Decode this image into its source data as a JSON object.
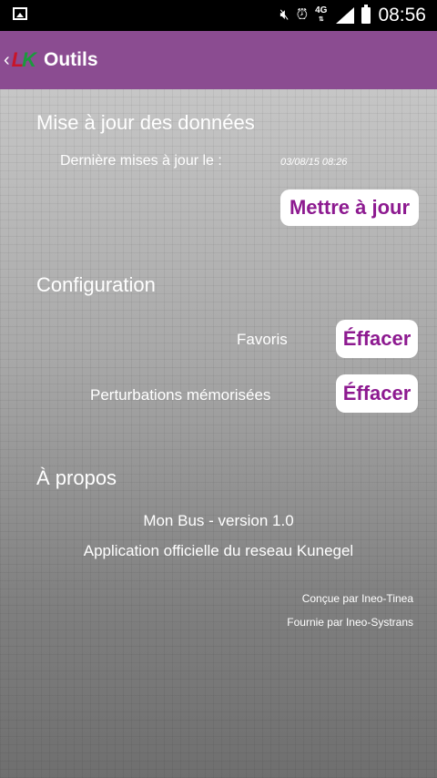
{
  "status_bar": {
    "network": "4G",
    "time": "08:56"
  },
  "app_bar": {
    "logo_text_1": "L",
    "logo_text_2": "K",
    "title": "Outils"
  },
  "update_section": {
    "title": "Mise à jour des données",
    "last_update_label": "Dernière mises à jour le :",
    "last_update_value": "03/08/15 08:26",
    "update_button": "Mettre à jour"
  },
  "config_section": {
    "title": "Configuration",
    "favorites_label": "Favoris",
    "favorites_button": "Éffacer",
    "disruptions_label": "Perturbations mémorisées",
    "disruptions_button": "Éffacer"
  },
  "about_section": {
    "title": "À propos",
    "version": "Mon Bus - version 1.0",
    "description": "Application officielle du reseau Kunegel",
    "designed_by": "Conçue par Ineo-Tinea",
    "provided_by": "Fournie par Ineo-Systrans"
  }
}
